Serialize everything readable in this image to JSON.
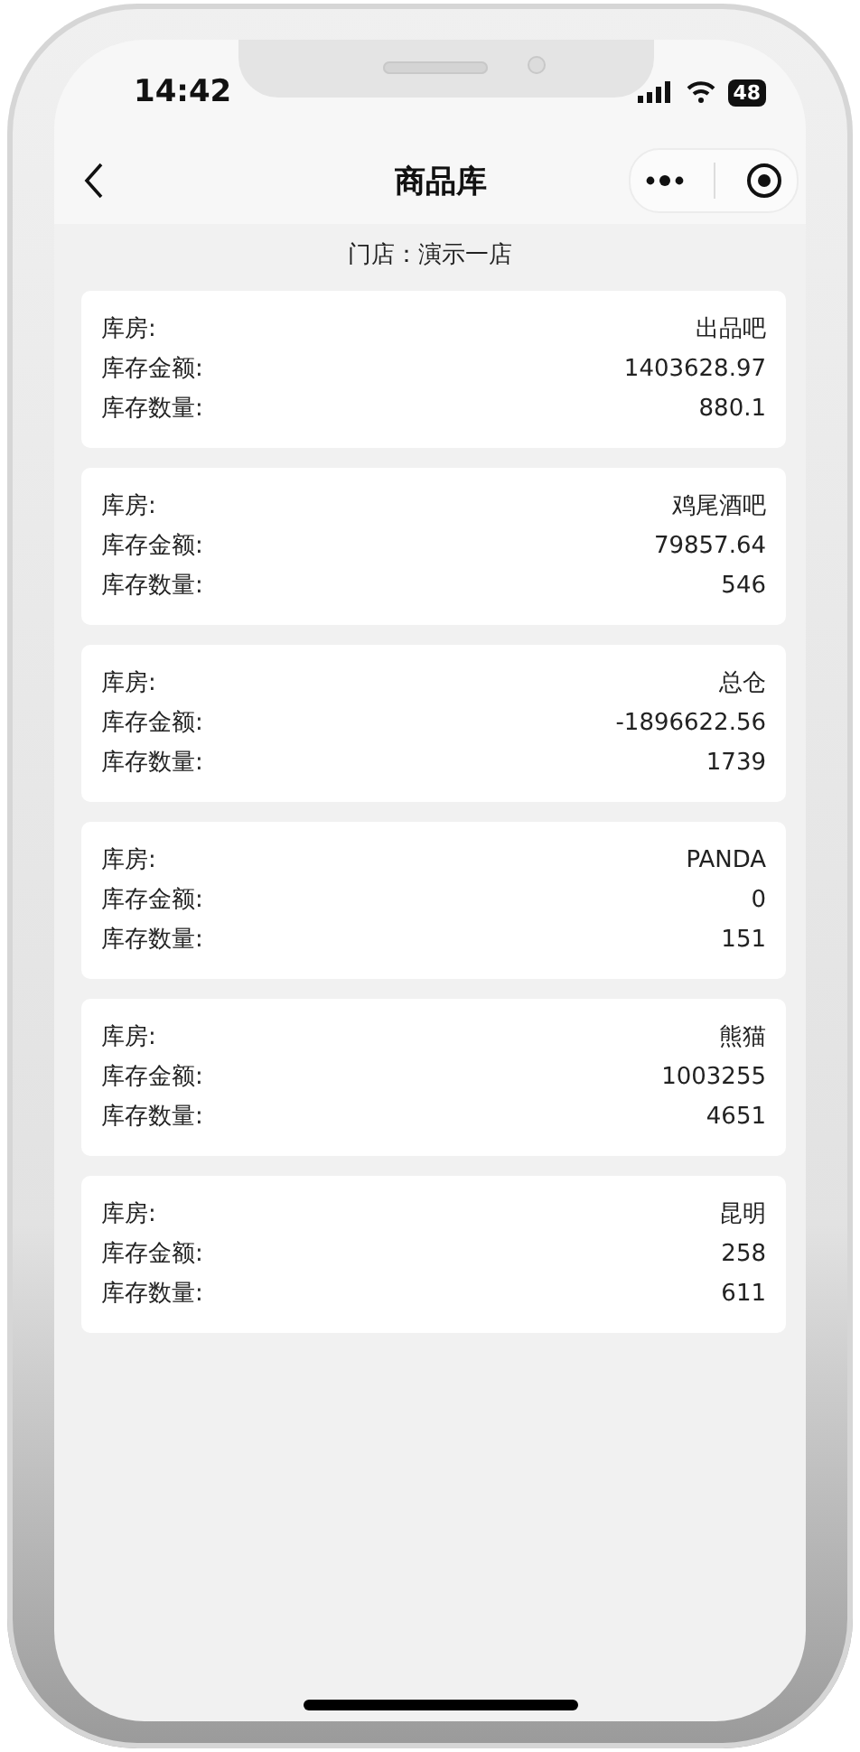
{
  "status_bar": {
    "time": "14:42",
    "battery": "48"
  },
  "nav": {
    "title": "商品库"
  },
  "store": {
    "label": "门店：演示一店"
  },
  "warehouses": [
    {
      "fields": [
        {
          "label": "库房:",
          "value": "出品吧"
        },
        {
          "label": "库存金额:",
          "value": "1403628.97"
        },
        {
          "label": "库存数量:",
          "value": "880.1"
        }
      ]
    },
    {
      "fields": [
        {
          "label": "库房:",
          "value": "鸡尾酒吧"
        },
        {
          "label": "库存金额:",
          "value": "79857.64"
        },
        {
          "label": "库存数量:",
          "value": "546"
        }
      ]
    },
    {
      "fields": [
        {
          "label": "库房:",
          "value": "总仓"
        },
        {
          "label": "库存金额:",
          "value": "-1896622.56"
        },
        {
          "label": "库存数量:",
          "value": "1739"
        }
      ]
    },
    {
      "fields": [
        {
          "label": "库房:",
          "value": "PANDA"
        },
        {
          "label": "库存金额:",
          "value": "0"
        },
        {
          "label": "库存数量:",
          "value": "151"
        }
      ]
    },
    {
      "fields": [
        {
          "label": "库房:",
          "value": "熊猫"
        },
        {
          "label": "库存金额:",
          "value": "1003255"
        },
        {
          "label": "库存数量:",
          "value": "4651"
        }
      ]
    },
    {
      "fields": [
        {
          "label": "库房:",
          "value": "昆明"
        },
        {
          "label": "库存金额:",
          "value": "258"
        },
        {
          "label": "库存数量:",
          "value": "611"
        }
      ]
    }
  ]
}
